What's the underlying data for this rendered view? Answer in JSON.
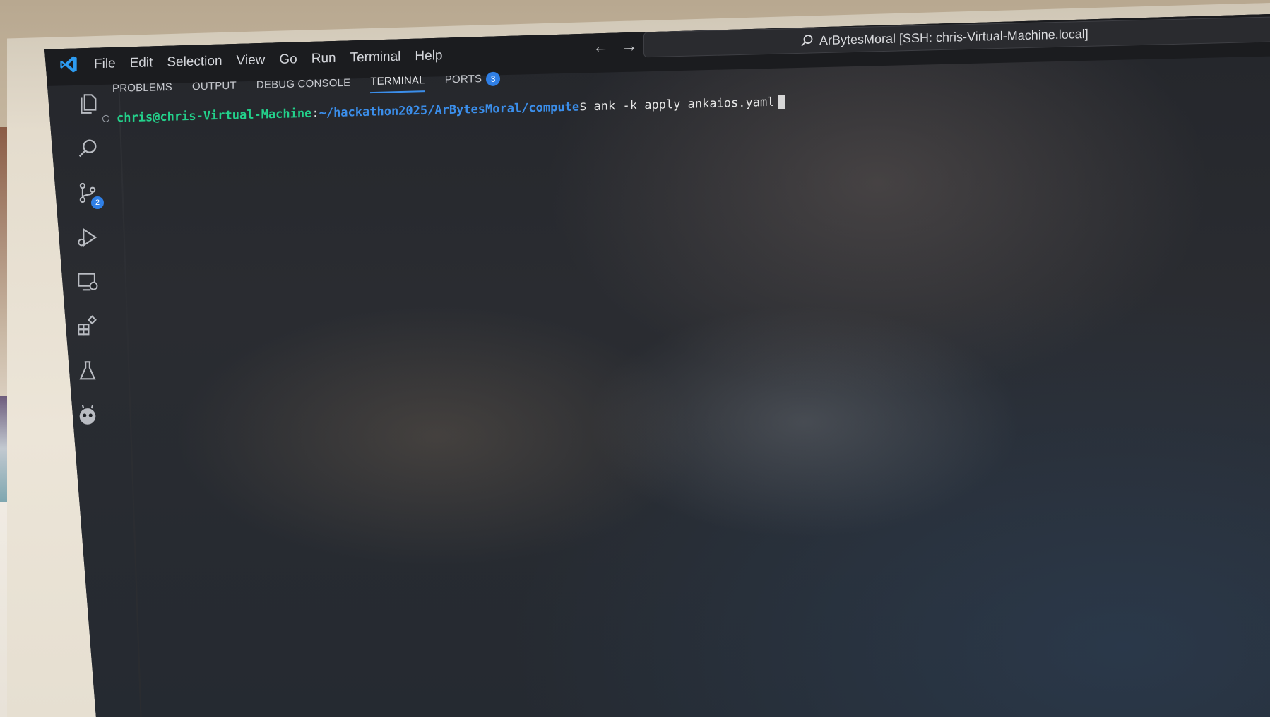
{
  "window": {
    "search_text": "ArBytesMoral [SSH: chris-Virtual-Machine.local]"
  },
  "menu": [
    "File",
    "Edit",
    "Selection",
    "View",
    "Go",
    "Run",
    "Terminal",
    "Help"
  ],
  "nav": {
    "back": "←",
    "forward": "→"
  },
  "activity_bar": {
    "source_control_badge": "2"
  },
  "panel": {
    "tabs": [
      {
        "label": "PROBLEMS",
        "active": false
      },
      {
        "label": "OUTPUT",
        "active": false
      },
      {
        "label": "DEBUG CONSOLE",
        "active": false
      },
      {
        "label": "TERMINAL",
        "active": true
      },
      {
        "label": "PORTS",
        "active": false,
        "badge": "3"
      }
    ]
  },
  "terminal": {
    "user_host": "chris@chris-Virtual-Machine",
    "separator": ":",
    "path": "~/hackathon2025/ArBytesMoral/compute",
    "dollar": "$",
    "command": "ank -k apply ankaios.yaml"
  },
  "colors": {
    "accent": "#3b8eea",
    "prompt_green": "#23d18b",
    "badge_blue": "#2f7fe6"
  }
}
